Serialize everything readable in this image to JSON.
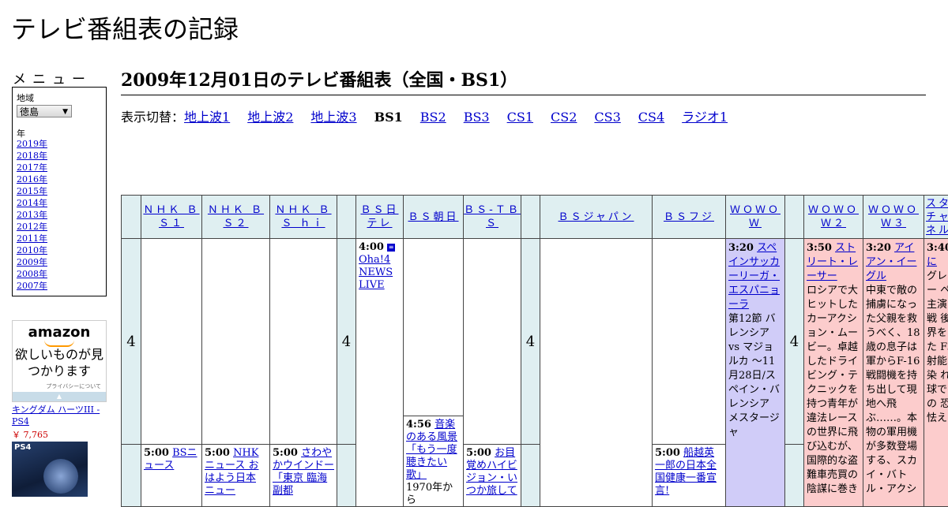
{
  "site_title": "テレビ番組表の記録",
  "menu": {
    "label": "メニュー",
    "region_label": "地域",
    "region_value": "徳島",
    "year_label": "年",
    "years": [
      "2019年",
      "2018年",
      "2017年",
      "2016年",
      "2015年",
      "2014年",
      "2013年",
      "2012年",
      "2011年",
      "2010年",
      "2009年",
      "2008年",
      "2007年"
    ]
  },
  "ad": {
    "logo": "amazon",
    "copy": "欲しいものが見つかります",
    "privacy": "プライバシーについて",
    "product_name": "キングダム ハーツIII - PS4",
    "product_price": "￥ 7,765",
    "product_badge": "PS4"
  },
  "heading": "2009年12月01日のテレビ番組表（全国・BS1）",
  "switcher": {
    "prefix": "表示切替：",
    "items": [
      {
        "label": "地上波1",
        "current": false
      },
      {
        "label": "地上波2",
        "current": false
      },
      {
        "label": "地上波3",
        "current": false
      },
      {
        "label": "BS1",
        "current": true
      },
      {
        "label": "BS2",
        "current": false
      },
      {
        "label": "BS3",
        "current": false
      },
      {
        "label": "CS1",
        "current": false
      },
      {
        "label": "CS2",
        "current": false
      },
      {
        "label": "CS3",
        "current": false
      },
      {
        "label": "CS4",
        "current": false
      },
      {
        "label": "ラジオ1",
        "current": false
      }
    ]
  },
  "channels": [
    "ＮＨＫ ＢＳ１",
    "ＮＨＫ ＢＳ２",
    "ＮＨＫ ＢＳ ｈｉ",
    "ＢＳ日テレ",
    "ＢＳ朝日",
    "ＢＳ-ＴＢＳ",
    "ＢＳジャパン",
    "ＢＳフジ",
    "ＷＯＷＯＷ",
    "ＷＯＷＯＷ２",
    "ＷＯＷＯＷ３",
    "スターチャンネル"
  ],
  "hour_label": "4",
  "programs": {
    "ntv_400": {
      "time": "4:00",
      "title": "Oha!4 NEWS LIVE",
      "icon": "data-broadcast-icon"
    },
    "asahi_456": {
      "time": "4:56",
      "title": "音楽のある風景「もう一度聴きたい歌」",
      "desc": "1970年から"
    },
    "tbs_500": {
      "time": "5:00",
      "title": "お目覚めハイビジョン・いつか旅して"
    },
    "bs1_500": {
      "time": "5:00",
      "title": "BSニュース"
    },
    "bs2_500": {
      "time": "5:00",
      "title": "NHKニュース おはよう日本 ニュー"
    },
    "hi_500": {
      "time": "5:00",
      "title": "さわやかウインドー「東京 臨海副都"
    },
    "fuji_500": {
      "time": "5:00",
      "title": "船越英一郎の日本全国健康一番宣言!"
    },
    "wowow_320": {
      "time": "3:20",
      "title": "スペインサッカーリーガ・エスパニョーラ",
      "desc": "第12節 バレンシア vs マジョルカ ～11月28日/スペイン・バレンシア メスタージャ"
    },
    "wowow2_350": {
      "time": "3:50",
      "title": "ストリート・レーサー",
      "desc": "ロシアで大ヒットしたカーアクション・ムービー。卓越したドライビング・テクニックを持つ青年が違法レースの世界に飛び込むが、国際的な盗難車売買の陰謀に巻き"
    },
    "wowow3_320": {
      "time": "3:20",
      "title": "アイアン・イーグル",
      "desc": "中東で敵の捕虜になった父親を救うべく、18歳の息子は軍からF-16戦闘機を持ち出して現地へ飛ぶ……。本物の軍用機が多数登場する、スカイ・バトル・アクシ"
    },
    "star_340": {
      "time": "3:40",
      "title": "渚に",
      "desc": "グレ リー ペッ 主演 核戦 後の 界を いた F。 射能 汚染 れた 球で 人の 恐怖 怯え"
    }
  },
  "colors": {
    "header_bg": "#dfeff1",
    "wowow_bg": "#d0ccf8",
    "movie_bg": "#fccccc",
    "link": "#0000cc"
  }
}
